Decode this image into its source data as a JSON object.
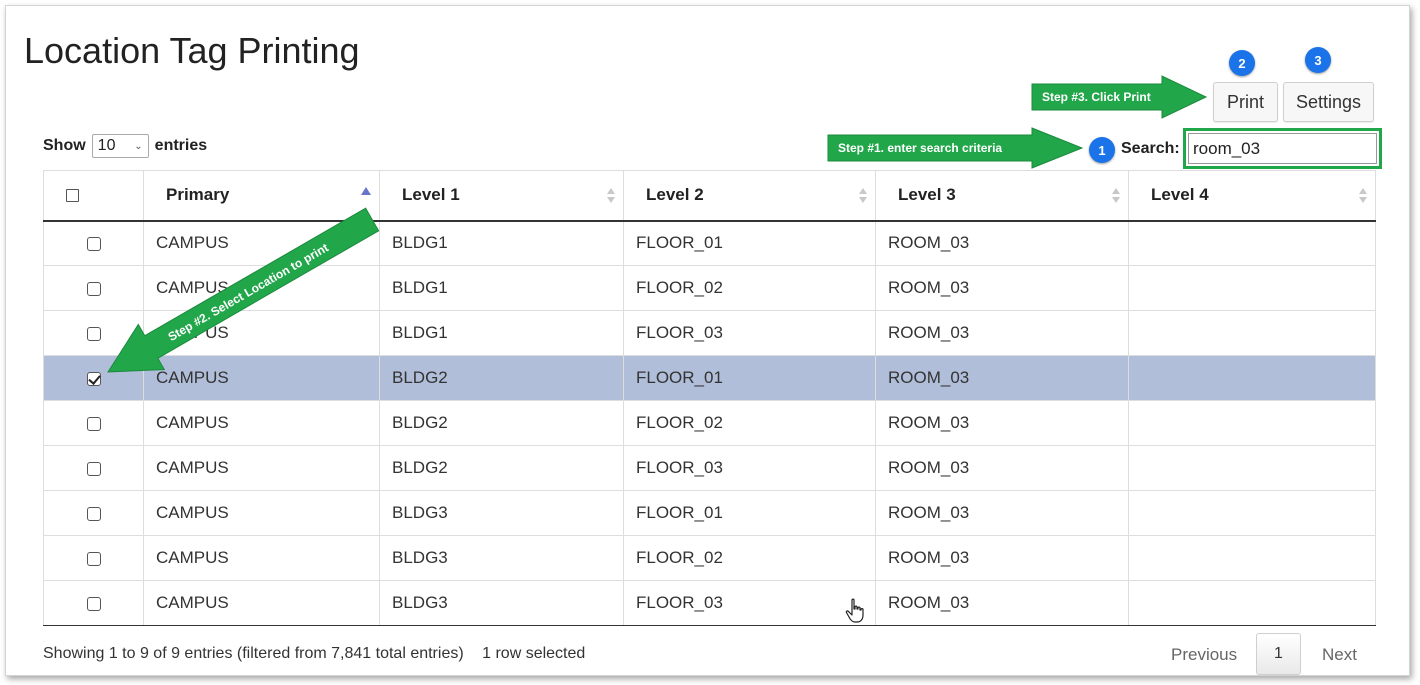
{
  "page": {
    "title": "Location Tag Printing"
  },
  "toolbar": {
    "print_label": "Print",
    "settings_label": "Settings"
  },
  "badges": {
    "one": "1",
    "two": "2",
    "three": "3"
  },
  "annotations": {
    "step1": "Step #1. enter search criteria",
    "step2": "Step #2. Select Location to print",
    "step3": "Step #3. Click Print"
  },
  "length_menu": {
    "show": "Show",
    "selected": "10",
    "entries": "entries"
  },
  "search": {
    "label": "Search:",
    "value": "room_03"
  },
  "table": {
    "columns": [
      "Primary",
      "Level 1",
      "Level 2",
      "Level 3",
      "Level 4"
    ],
    "rows": [
      {
        "checked": false,
        "primary": "CAMPUS",
        "level1": "BLDG1",
        "level2": "FLOOR_01",
        "level3": "ROOM_03",
        "level4": ""
      },
      {
        "checked": false,
        "primary": "CAMPUS",
        "level1": "BLDG1",
        "level2": "FLOOR_02",
        "level3": "ROOM_03",
        "level4": ""
      },
      {
        "checked": false,
        "primary": "CAMPUS",
        "level1": "BLDG1",
        "level2": "FLOOR_03",
        "level3": "ROOM_03",
        "level4": ""
      },
      {
        "checked": true,
        "primary": "CAMPUS",
        "level1": "BLDG2",
        "level2": "FLOOR_01",
        "level3": "ROOM_03",
        "level4": ""
      },
      {
        "checked": false,
        "primary": "CAMPUS",
        "level1": "BLDG2",
        "level2": "FLOOR_02",
        "level3": "ROOM_03",
        "level4": ""
      },
      {
        "checked": false,
        "primary": "CAMPUS",
        "level1": "BLDG2",
        "level2": "FLOOR_03",
        "level3": "ROOM_03",
        "level4": ""
      },
      {
        "checked": false,
        "primary": "CAMPUS",
        "level1": "BLDG3",
        "level2": "FLOOR_01",
        "level3": "ROOM_03",
        "level4": ""
      },
      {
        "checked": false,
        "primary": "CAMPUS",
        "level1": "BLDG3",
        "level2": "FLOOR_02",
        "level3": "ROOM_03",
        "level4": ""
      },
      {
        "checked": false,
        "primary": "CAMPUS",
        "level1": "BLDG3",
        "level2": "FLOOR_03",
        "level3": "ROOM_03",
        "level4": ""
      }
    ]
  },
  "footer": {
    "info": "Showing 1 to 9 of 9 entries (filtered from 7,841 total entries)",
    "selected": "1 row selected",
    "previous": "Previous",
    "page": "1",
    "next": "Next"
  },
  "colors": {
    "selected_row": "#b0bed9",
    "annotation_green": "#22a64a",
    "badge_blue": "#1a73e8"
  },
  "icons": {
    "sort_both": "sort-both-icon",
    "sort_asc": "sort-asc-icon",
    "cursor": "hand-pointer-icon",
    "select_chevron": "chevron-down-icon"
  }
}
